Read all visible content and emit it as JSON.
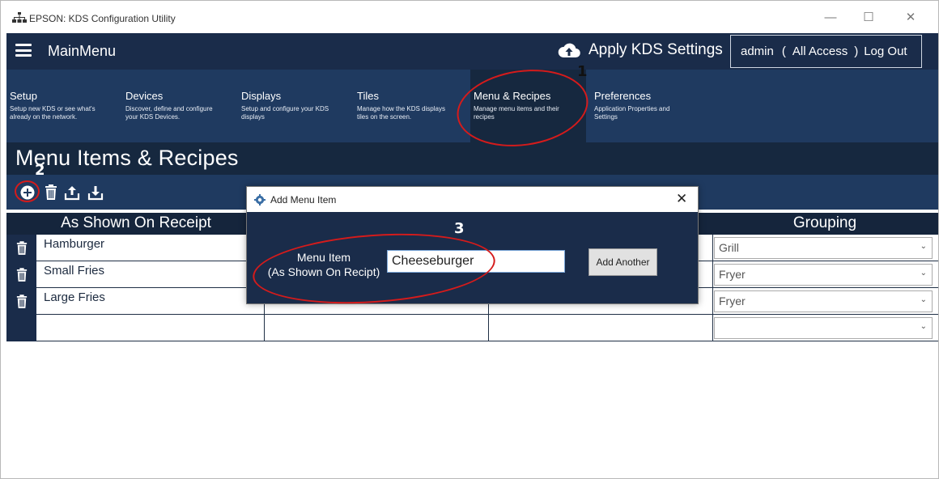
{
  "window": {
    "title": "EPSON: KDS Configuration Utility",
    "controls": {
      "minimize": "—",
      "maximize": "☐",
      "close": "✕"
    }
  },
  "header": {
    "menu_label": "MainMenu",
    "apply_label": "Apply KDS Settings",
    "user": {
      "name": "admin",
      "open_paren": "(",
      "access": "All Access",
      "close_paren": ")",
      "logout": "Log Out"
    }
  },
  "nav": {
    "tabs": [
      {
        "label": "Setup",
        "desc1": "Setup new KDS or see what's",
        "desc2": "already on the network."
      },
      {
        "label": "Devices",
        "desc1": "Discover, define and configure",
        "desc2": "your KDS Devices."
      },
      {
        "label": "Displays",
        "desc1": "Setup and configure your KDS",
        "desc2": "displays"
      },
      {
        "label": "Tiles",
        "desc1": "Manage how the KDS displays",
        "desc2": "tiles on the screen."
      },
      {
        "label": "Menu & Recipes",
        "desc1": "Manage menu items and their",
        "desc2": "recipes",
        "active": true
      },
      {
        "label": "Preferences",
        "desc1": "Application Properties and",
        "desc2": "Settings"
      }
    ]
  },
  "page": {
    "title": "Menu Items & Recipes"
  },
  "toolbar": {
    "icons": [
      "add-circle-icon",
      "trash-icon",
      "upload-icon",
      "download-icon"
    ]
  },
  "grid": {
    "columns": [
      "As Shown On Receipt",
      "Grouping"
    ],
    "rows": [
      {
        "name": "Hamburger",
        "grouping": "Grill"
      },
      {
        "name": "Small Fries",
        "grouping": "Fryer"
      },
      {
        "name": "Large Fries",
        "grouping": "Fryer"
      },
      {
        "name": "",
        "grouping": ""
      }
    ]
  },
  "dialog": {
    "title": "Add Menu Item",
    "close": "✕",
    "label_line1": "Menu Item",
    "label_line2": "(As Shown On Recipt)",
    "input_value": "Cheeseburger",
    "button_label": "Add Another"
  },
  "annotations": {
    "n1": "1",
    "n2": "2",
    "n3": "3"
  },
  "colors": {
    "header": "#1a2c4a",
    "nav": "#1f3a60",
    "active_tab": "#16283f",
    "annotation_red": "#d51b1b"
  }
}
